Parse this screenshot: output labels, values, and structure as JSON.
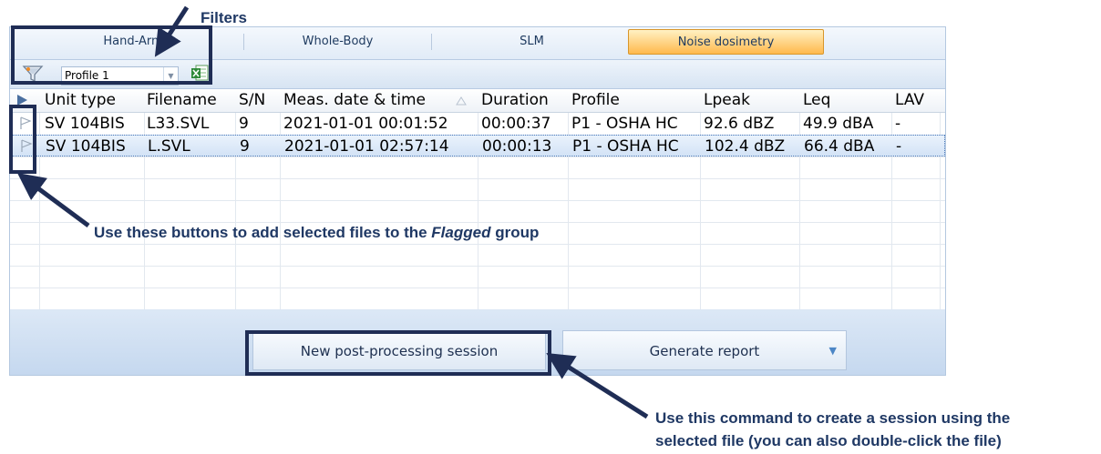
{
  "tabs": [
    {
      "label": "Hand-Arm",
      "active": false
    },
    {
      "label": "Whole-Body",
      "active": false
    },
    {
      "label": "SLM",
      "active": false
    },
    {
      "label": "Noise dosimetry",
      "active": true
    }
  ],
  "toolbar": {
    "profile_value": "Profile 1",
    "filter_icon": "filter-funnel-icon",
    "export_icon": "excel-export-icon"
  },
  "table": {
    "columns": [
      "Unit type",
      "Filename",
      "S/N",
      "Meas. date & time",
      "Duration",
      "Profile",
      "Lpeak",
      "Leq",
      "LAV"
    ],
    "sort_column": "Meas. date & time",
    "rows": [
      {
        "unit_type": "SV 104BIS",
        "filename": "L33.SVL",
        "sn": "9",
        "datetime": "2021-01-01 00:01:52",
        "duration": "00:00:37",
        "profile": "P1 - OSHA HC",
        "lpeak": "92.6 dBZ",
        "leq": "49.9 dBA",
        "lav": "-",
        "selected": false
      },
      {
        "unit_type": "SV 104BIS",
        "filename": "L.SVL",
        "sn": "9",
        "datetime": "2021-01-01 02:57:14",
        "duration": "00:00:13",
        "profile": "P1 - OSHA HC",
        "lpeak": "102.4 dBZ",
        "leq": "66.4 dBA",
        "lav": "-",
        "selected": true
      }
    ]
  },
  "buttons": {
    "new_session": "New post-processing session",
    "generate_report": "Generate report"
  },
  "annotations": {
    "filters": "Filters",
    "flag_help_prefix": "Use these buttons to add selected files to the ",
    "flag_help_group": "Flagged",
    "flag_help_suffix": " group",
    "session_help_line1": "Use this command to create a session using the",
    "session_help_line2": "selected file (you can also double-click the file)"
  },
  "colors": {
    "annotation": "#1f2d55",
    "active_tab": "#ffb94d",
    "panel": "#dbe7f5"
  }
}
